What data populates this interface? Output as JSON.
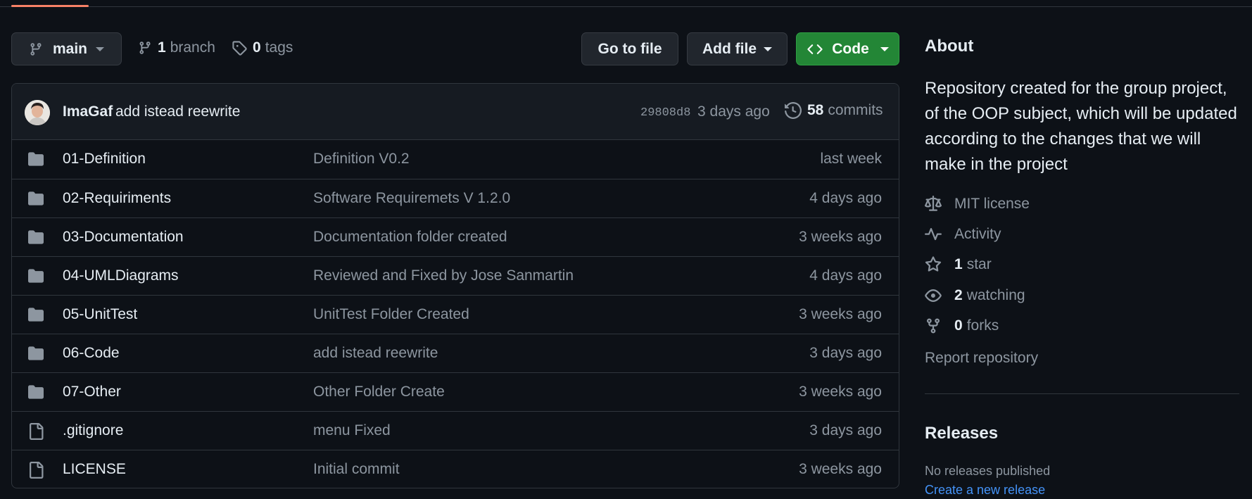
{
  "toolbar": {
    "branch_name": "main",
    "branches_count": "1",
    "branches_label": "branch",
    "tags_count": "0",
    "tags_label": "tags",
    "go_to_file": "Go to file",
    "add_file": "Add file",
    "code": "Code"
  },
  "commit": {
    "author": "ImaGaf",
    "message": "add istead reewrite",
    "sha": "29808d8",
    "age": "3 days ago",
    "count": "58",
    "count_label": "commits"
  },
  "files": [
    {
      "name": "01-Definition",
      "type": "folder",
      "message": "Definition V0.2",
      "age": "last week"
    },
    {
      "name": "02-Requiriments",
      "type": "folder",
      "message": "Software Requiremets V 1.2.0",
      "age": "4 days ago"
    },
    {
      "name": "03-Documentation",
      "type": "folder",
      "message": "Documentation folder created",
      "age": "3 weeks ago"
    },
    {
      "name": "04-UMLDiagrams",
      "type": "folder",
      "message": "Reviewed and Fixed by Jose Sanmartin",
      "age": "4 days ago"
    },
    {
      "name": "05-UnitTest",
      "type": "folder",
      "message": "UnitTest Folder Created",
      "age": "3 weeks ago"
    },
    {
      "name": "06-Code",
      "type": "folder",
      "message": "add istead reewrite",
      "age": "3 days ago"
    },
    {
      "name": "07-Other",
      "type": "folder",
      "message": "Other Folder Create",
      "age": "3 weeks ago"
    },
    {
      "name": ".gitignore",
      "type": "file",
      "message": "menu Fixed",
      "age": "3 days ago"
    },
    {
      "name": "LICENSE",
      "type": "file",
      "message": "Initial commit",
      "age": "3 weeks ago"
    }
  ],
  "about": {
    "title": "About",
    "description": "Repository created for the group project, of the OOP subject, which will be updated according to the changes that we will make in the project",
    "license": "MIT license",
    "activity": "Activity",
    "stars_count": "1",
    "stars_label": "star",
    "watching_count": "2",
    "watching_label": "watching",
    "forks_count": "0",
    "forks_label": "forks",
    "report": "Report repository"
  },
  "releases": {
    "title": "Releases",
    "none": "No releases published",
    "create_link": "Create a new release"
  },
  "colors": {
    "background": "#0d1117",
    "accent_green": "#238636",
    "link_blue": "#4493f8",
    "muted": "#8d96a0"
  }
}
